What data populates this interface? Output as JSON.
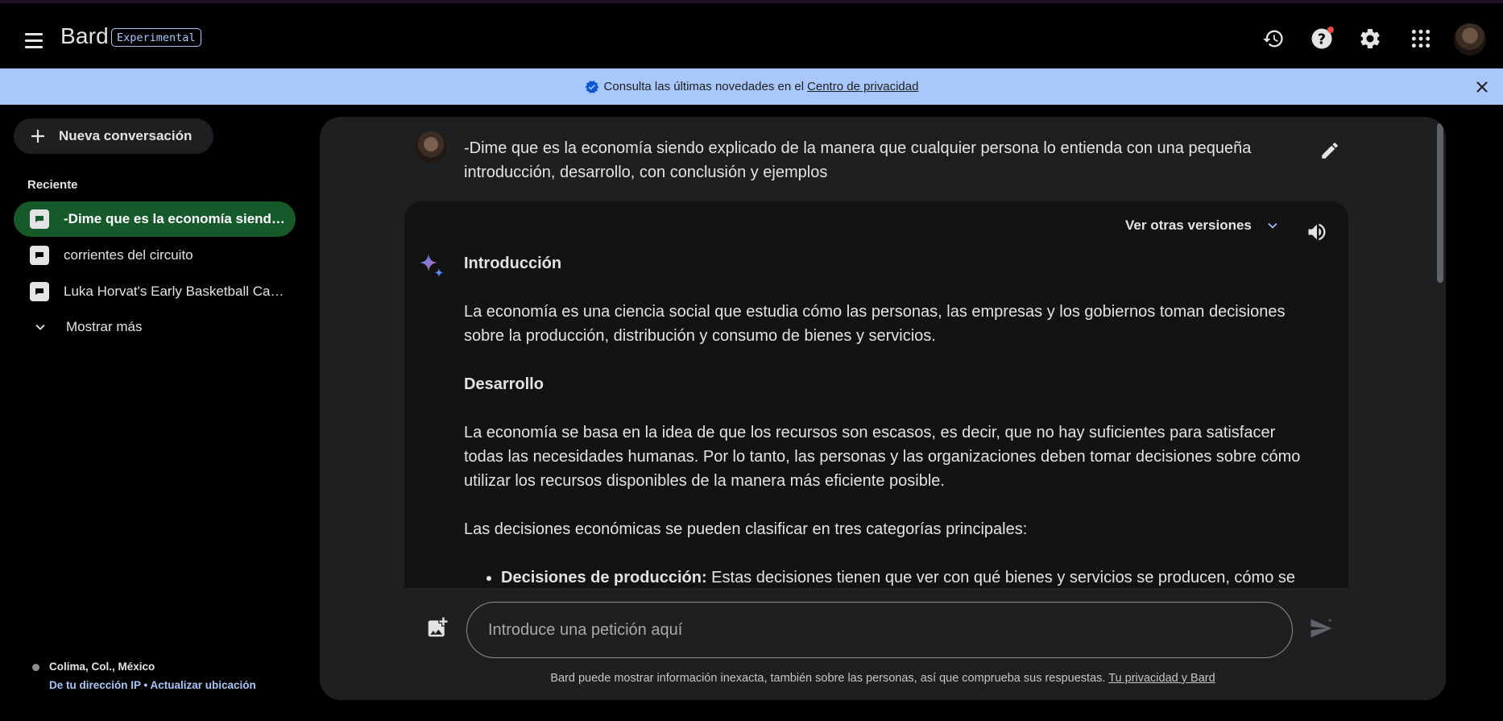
{
  "header": {
    "brand": "Bard",
    "badge": "Experimental",
    "icons": [
      "menu-icon",
      "history-icon",
      "help-icon",
      "settings-icon",
      "apps-icon",
      "avatar"
    ]
  },
  "banner": {
    "text": "Consulta las últimas novedades en el",
    "link": "Centro de privacidad"
  },
  "sidebar": {
    "new_chat": "Nueva conversación",
    "recent_title": "Reciente",
    "items": [
      {
        "label": "-Dime que es la economía siendo explicado de la manera que cualquier persona lo entienda",
        "active": true
      },
      {
        "label": "corrientes del circuito",
        "active": false
      },
      {
        "label": "Luka Horvat's Early Basketball Career",
        "active": false
      }
    ],
    "show_more": "Mostrar más",
    "location": {
      "city": "Colima, Col., México",
      "source": "De tu dirección IP",
      "separator": " • ",
      "update": "Actualizar ubicación"
    }
  },
  "chat": {
    "prompt": "-Dime que es la economía siendo explicado de la manera que cualquier persona lo entienda con una pequeña introducción, desarrollo, con conclusión y ejemplos",
    "versions_label": "Ver otras versiones",
    "response": {
      "h1": "Introducción",
      "p1": "La economía es una ciencia social que estudia cómo las personas, las empresas y los gobiernos toman decisiones sobre la producción, distribución y consumo de bienes y servicios.",
      "h2": "Desarrollo",
      "p2": "La economía se basa en la idea de que los recursos son escasos, es decir, que no hay suficientes para satisfacer todas las necesidades humanas. Por lo tanto, las personas y las organizaciones deben tomar decisiones sobre cómo utilizar los recursos disponibles de la manera más eficiente posible.",
      "p3": "Las decisiones económicas se pueden clasificar en tres categorías principales:",
      "bullet1_bold": "Decisiones de producción:",
      "bullet1_text": " Estas decisiones tienen que ver con qué bienes y servicios se producen, cómo se"
    }
  },
  "input": {
    "placeholder": "Introduce una petición aquí"
  },
  "footer": {
    "disclaimer": "Bard puede mostrar información inexacta, también sobre las personas, así que comprueba sus respuestas.",
    "link": "Tu privacidad y Bard"
  },
  "colors": {
    "banner": "#a8c7fa",
    "active_item": "#165a2c",
    "panel": "#1e1f20",
    "response_bg": "#131314"
  }
}
